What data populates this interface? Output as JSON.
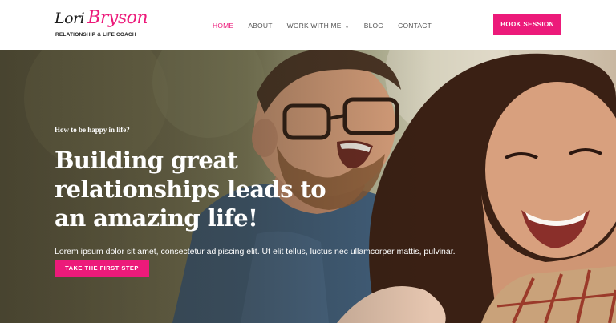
{
  "brand": {
    "logo_first": "Lori",
    "logo_last": "Bryson",
    "tagline": "RELATIONSHIP & LIFE COACH",
    "accent_color": "#ec1a7a"
  },
  "nav": {
    "items": [
      {
        "label": "HOME",
        "active": true
      },
      {
        "label": "ABOUT",
        "active": false
      },
      {
        "label": "WORK WITH ME",
        "active": false,
        "has_dropdown": true
      },
      {
        "label": "BLOG",
        "active": false
      },
      {
        "label": "CONTACT",
        "active": false
      }
    ],
    "dropdown_icon": "chevron-down-icon"
  },
  "header": {
    "book_label": "BOOK SESSION"
  },
  "hero": {
    "eyebrow": "How to be happy in life?",
    "headline": "Building great relationships leads to an amazing life!",
    "body": "Lorem ipsum dolor sit amet, consectetur adipiscing elit. Ut elit tellus, luctus nec ullamcorper mattis, pulvinar.",
    "cta_label": "TAKE THE FIRST STEP"
  }
}
